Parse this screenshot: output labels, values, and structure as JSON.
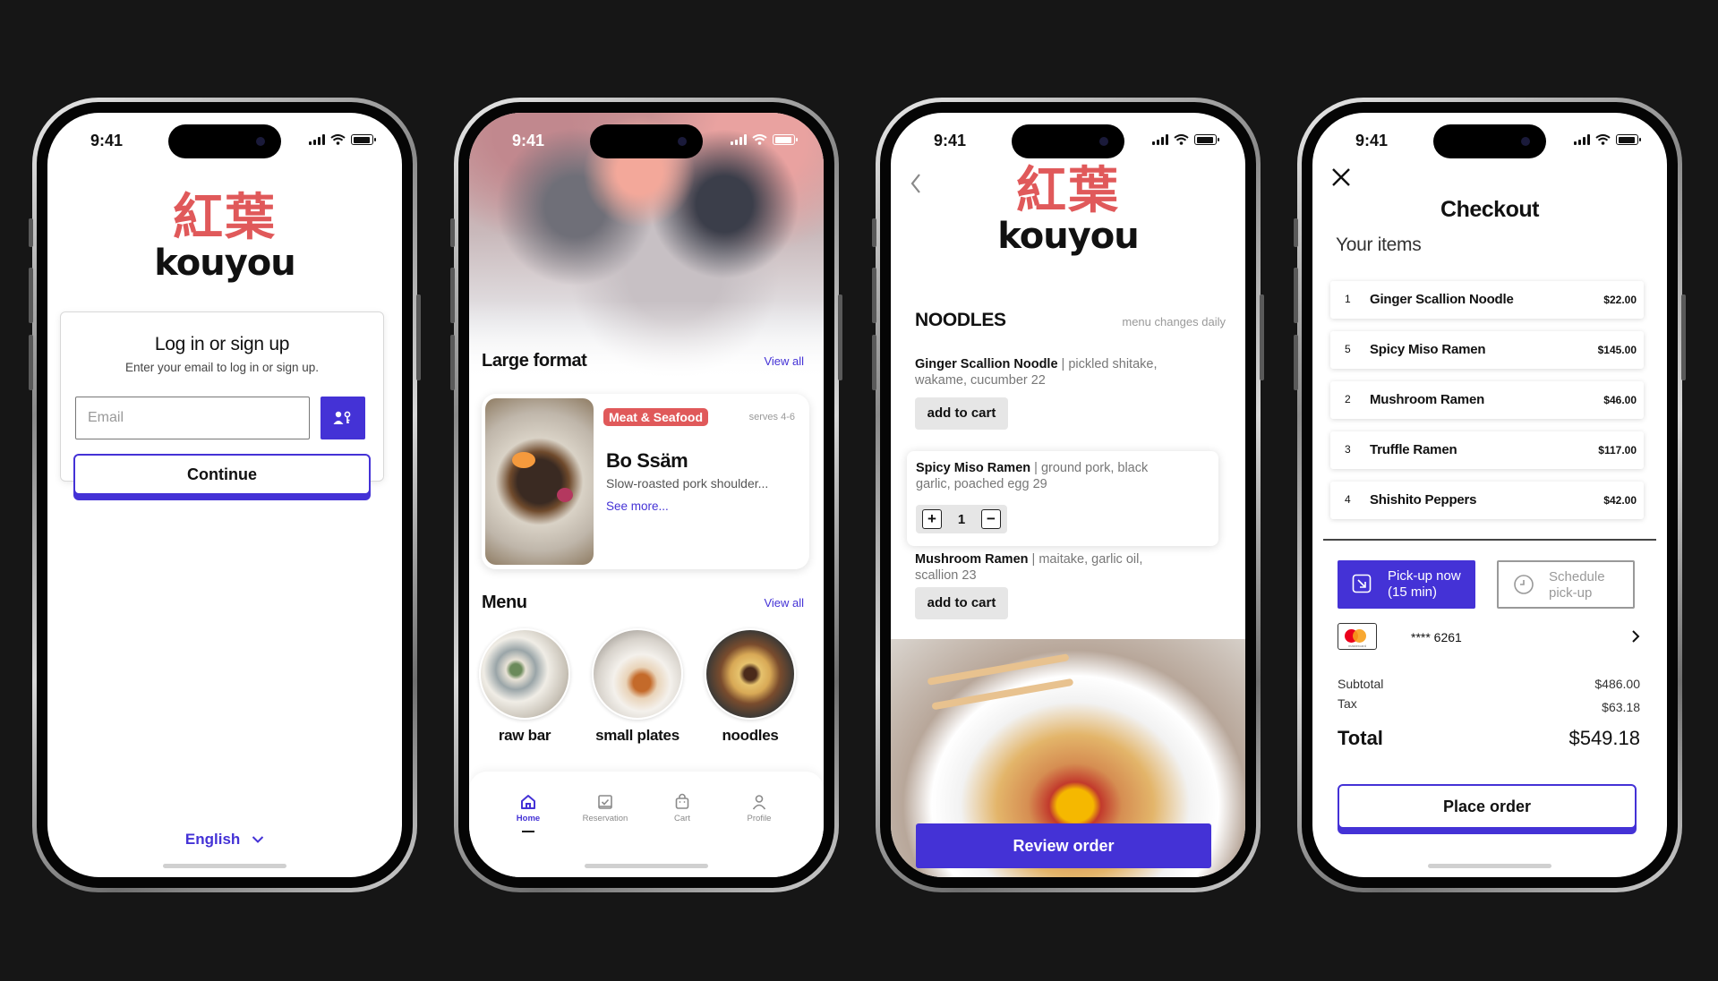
{
  "colors": {
    "accent": "#4432d6",
    "brand_red": "#e0595a",
    "background": "#161616"
  },
  "status_bar": {
    "time": "9:41"
  },
  "brand": {
    "japanese": "紅葉",
    "roman": "kouyou"
  },
  "login": {
    "title": "Log in or sign up",
    "subtitle": "Enter your email to log in or sign up.",
    "email_placeholder": "Email",
    "passkey_icon": "person-key-icon",
    "continue_label": "Continue",
    "language": "English"
  },
  "home": {
    "large_format": {
      "title": "Large format",
      "view_all": "View all",
      "card": {
        "tag": "Meat & Seafood",
        "serves": "serves 4-6",
        "name": "Bo Ssäm",
        "description": "Slow-roasted pork shoulder...",
        "see_more": "See more..."
      }
    },
    "menu": {
      "title": "Menu",
      "view_all": "View all",
      "categories": [
        {
          "label": "raw bar"
        },
        {
          "label": "small plates"
        },
        {
          "label": "noodles"
        }
      ]
    },
    "tabs": [
      {
        "label": "Home",
        "icon": "home-icon",
        "active": true
      },
      {
        "label": "Reservation",
        "icon": "calendar-check-icon",
        "active": false
      },
      {
        "label": "Cart",
        "icon": "bag-icon",
        "active": false
      },
      {
        "label": "Profile",
        "icon": "person-icon",
        "active": false
      }
    ]
  },
  "menu_page": {
    "section": "NOODLES",
    "note": "menu changes daily",
    "items": [
      {
        "name": "Ginger Scallion  Noodle",
        "desc": " | pickled shitake, wakame, cucumber 22",
        "action": "add to cart"
      },
      {
        "name": "Spicy Miso Ramen",
        "desc": " | ground pork, black garlic, poached egg 29",
        "quantity": "1"
      },
      {
        "name": "Mushroom Ramen",
        "desc": " | maitake, garlic oil, scallion 23",
        "action": "add to cart"
      }
    ],
    "review_label": "Review order"
  },
  "checkout": {
    "title": "Checkout",
    "your_items": "Your items",
    "items": [
      {
        "qty": "1",
        "name": "Ginger Scallion Noodle",
        "price": "$22.00"
      },
      {
        "qty": "5",
        "name": "Spicy Miso Ramen",
        "price": "$145.00"
      },
      {
        "qty": "2",
        "name": "Mushroom Ramen",
        "price": "$46.00"
      },
      {
        "qty": "3",
        "name": "Truffle Ramen",
        "price": "$117.00"
      },
      {
        "qty": "4",
        "name": "Shishito Peppers",
        "price": "$42.00"
      }
    ],
    "pickup_now": "Pick-up now",
    "pickup_now_sub": "(15 min)",
    "schedule": "Schedule",
    "schedule_sub": "pick-up",
    "card_brand": "mastercard",
    "card_number": "**** 6261",
    "subtotal_label": "Subtotal",
    "subtotal": "$486.00",
    "tax_label": "Tax",
    "tax": "$63.18",
    "total_label": "Total",
    "total": "$549.18",
    "place_order": "Place order"
  }
}
